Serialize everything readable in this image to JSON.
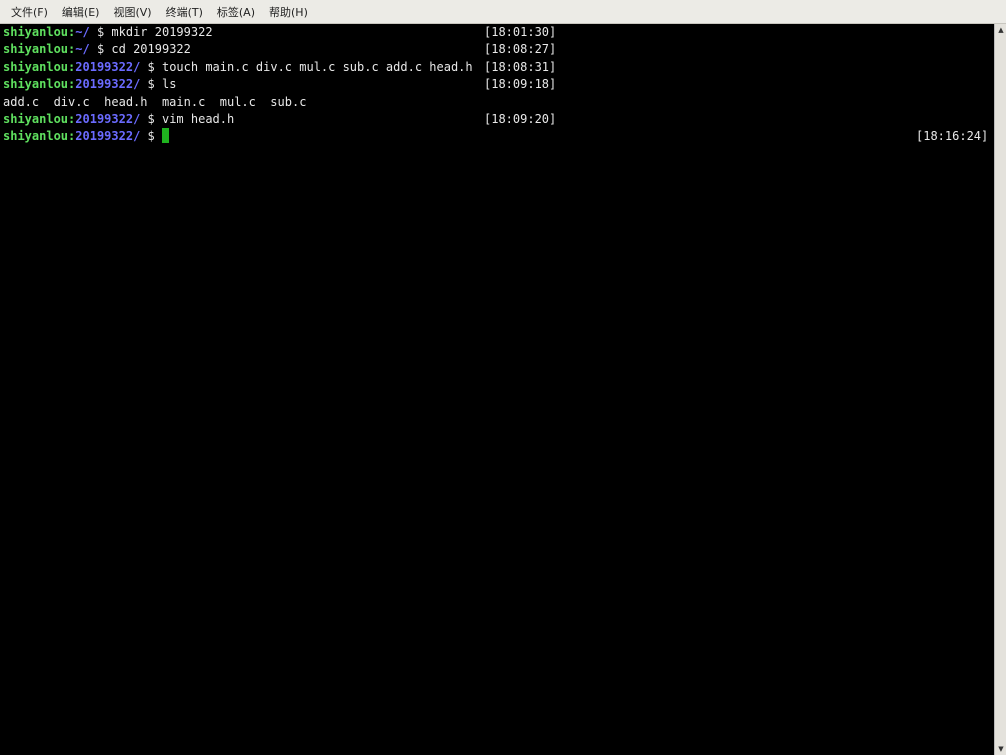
{
  "menu": [
    "文件(F)",
    "编辑(E)",
    "视图(V)",
    "终端(T)",
    "标签(A)",
    "帮助(H)"
  ],
  "lines": [
    {
      "user": "shiyanlou",
      "path": "~/",
      "cmd": " $ mkdir 20199322",
      "ts": "[18:01:30]"
    },
    {
      "user": "shiyanlou",
      "path": "~/",
      "cmd": " $ cd 20199322",
      "ts": "[18:08:27]"
    },
    {
      "user": "shiyanlou",
      "path": "20199322/",
      "cmd": " $ touch main.c div.c mul.c sub.c add.c head.h",
      "ts": "[18:08:31]"
    },
    {
      "user": "shiyanlou",
      "path": "20199322/",
      "cmd": " $ ls",
      "ts": "[18:09:18]"
    },
    {
      "output": "add.c  div.c  head.h  main.c  mul.c  sub.c"
    },
    {
      "user": "shiyanlou",
      "path": "20199322/",
      "cmd": " $ vim head.h",
      "ts": "[18:09:20]"
    },
    {
      "user": "shiyanlou",
      "path": "20199322/",
      "cmd": " $ ",
      "ts": "[18:16:24]"
    }
  ],
  "colors": {
    "user": "#5fe05f",
    "path": "#6b6bff",
    "cursor": "#1fb31f"
  },
  "scrollbar": {
    "up_icon": "▲",
    "down_icon": "▼"
  }
}
